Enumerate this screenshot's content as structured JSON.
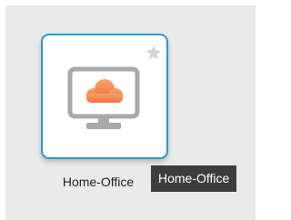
{
  "tile": {
    "label": "Home-Office",
    "icon": "monitor-cloud-icon",
    "favorite_icon": "star-icon",
    "favorited": false,
    "border_color": "#2a9bd0",
    "cloud_color": "#f47d4a"
  },
  "tooltip": {
    "text": "Home-Office"
  }
}
